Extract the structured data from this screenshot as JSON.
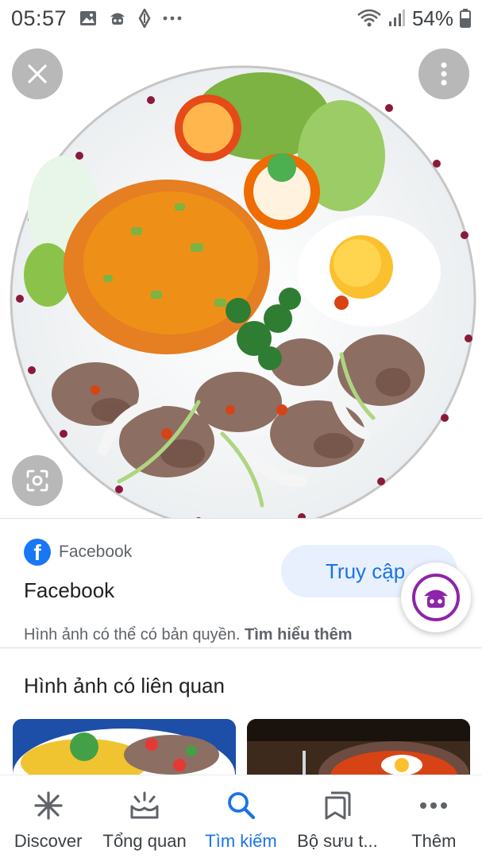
{
  "status_bar": {
    "time": "05:57",
    "battery": "54%"
  },
  "image_viewer": {
    "icons": [
      "close-icon",
      "more-vert-icon",
      "lens-icon"
    ]
  },
  "source": {
    "site_name": "Facebook",
    "title": "Facebook",
    "visit_label": "Truy cập",
    "copyright_text": "Hình ảnh có thể có bản quyền.",
    "learn_more": "Tìm hiểu thêm"
  },
  "related": {
    "title": "Hình ảnh có liên quan"
  },
  "bottom_nav": {
    "items": [
      {
        "label": "Discover",
        "icon": "asterisk-icon"
      },
      {
        "label": "Tổng quan",
        "icon": "updates-icon"
      },
      {
        "label": "Tìm kiếm",
        "icon": "search-icon"
      },
      {
        "label": "Bộ sưu t...",
        "icon": "collections-icon"
      },
      {
        "label": "Thêm",
        "icon": "more-horiz-icon"
      }
    ],
    "active_index": 2
  },
  "colors": {
    "accent": "#1a73e8",
    "facebook": "#1877f2",
    "fab_ring": "#8e24aa"
  }
}
